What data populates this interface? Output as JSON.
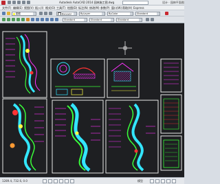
{
  "window": {
    "title": "Autodesk AutoCAD 2014  园林施工图.dwg",
    "side_label": "设计 · 园林平面图"
  },
  "menu": {
    "items": [
      "文件(F)",
      "编辑(E)",
      "视图(V)",
      "插入(I)",
      "格式(O)",
      "工具(T)",
      "绘图(D)",
      "标注(N)",
      "修改(M)",
      "参数(P)",
      "窗口(W)",
      "帮助(H)",
      "Express"
    ]
  },
  "toolbar": {
    "workspace_value": "ByLayer",
    "layer_value": "图框",
    "linetype_value": "ByLayer",
    "lineweight_value": "ByColor",
    "color_value": "Standard",
    "textstyle_value": "Standard",
    "dimstyle_value": "Standard",
    "tablestyle_value": "Standard"
  },
  "status": {
    "coordinates": "1289.4, 732.6, 0.0",
    "model_label": "模型"
  },
  "colors": {
    "accent": "#c9282f",
    "canvas": "#1e1f22",
    "frame": "#e8e8e8",
    "magenta": "#ff33ff",
    "cyan": "#33e6ff",
    "green": "#39ff3a",
    "yellow": "#ffff44",
    "red": "#ff3333"
  }
}
